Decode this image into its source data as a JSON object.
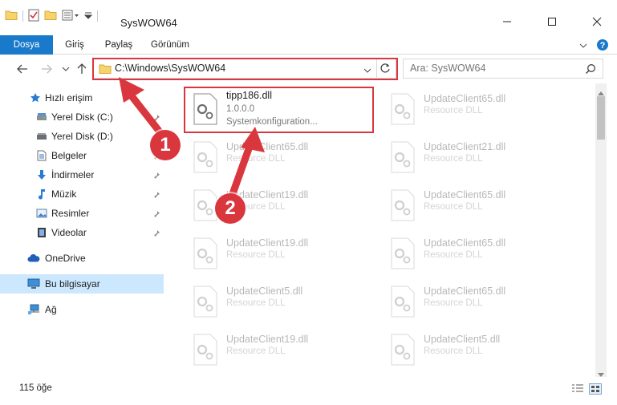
{
  "window": {
    "title": "SysWOW64",
    "minimize_icon": "minimize-icon",
    "maximize_icon": "maximize-icon",
    "close_icon": "close-icon"
  },
  "ribbon": {
    "tabs": [
      {
        "label": "Dosya",
        "active": true
      },
      {
        "label": "Giriş",
        "active": false
      },
      {
        "label": "Paylaş",
        "active": false
      },
      {
        "label": "Görünüm",
        "active": false
      }
    ]
  },
  "address": {
    "path": "C:\\Windows\\SysWOW64"
  },
  "search": {
    "placeholder": "Ara: SysWOW64"
  },
  "sidebar": {
    "items": [
      {
        "label": "Hızlı erişim",
        "icon": "star-icon"
      },
      {
        "label": "Yerel Disk (C:)",
        "icon": "drive-icon"
      },
      {
        "label": "Yerel Disk (D:)",
        "icon": "drive-icon"
      },
      {
        "label": "Belgeler",
        "icon": "documents-icon"
      },
      {
        "label": "İndirmeler",
        "icon": "downloads-icon"
      },
      {
        "label": "Müzik",
        "icon": "music-icon"
      },
      {
        "label": "Resimler",
        "icon": "pictures-icon"
      },
      {
        "label": "Videolar",
        "icon": "videos-icon"
      },
      {
        "label": "OneDrive",
        "icon": "cloud-icon"
      },
      {
        "label": "Bu bilgisayar",
        "icon": "computer-icon"
      },
      {
        "label": "Ağ",
        "icon": "network-icon"
      }
    ]
  },
  "files": {
    "highlighted": {
      "name": "tipp186.dll",
      "version": "1.0.0.0",
      "description": "Systemkonfiguration..."
    },
    "left_column": [
      {
        "name": "UpdateClient65.dll",
        "description": "Resource DLL"
      },
      {
        "name": "UpdateClient19.dll",
        "description": "Resource DLL"
      },
      {
        "name": "UpdateClient19.dll",
        "description": "Resource DLL"
      },
      {
        "name": "UpdateClient5.dll",
        "description": "Resource DLL"
      },
      {
        "name": "UpdateClient19.dll",
        "description": "Resource DLL"
      }
    ],
    "right_column": [
      {
        "name": "UpdateClient65.dll",
        "description": "Resource DLL"
      },
      {
        "name": "UpdateClient21.dll",
        "description": "Resource DLL"
      },
      {
        "name": "UpdateClient65.dll",
        "description": "Resource DLL"
      },
      {
        "name": "UpdateClient65.dll",
        "description": "Resource DLL"
      },
      {
        "name": "UpdateClient65.dll",
        "description": "Resource DLL"
      },
      {
        "name": "UpdateClient5.dll",
        "description": "Resource DLL"
      }
    ]
  },
  "status": {
    "count": "115 öğe"
  },
  "annotations": {
    "step1": "1",
    "step2": "2",
    "color": "#d9363e"
  },
  "colors": {
    "accent": "#1979ca",
    "selected": "#cce8ff"
  }
}
